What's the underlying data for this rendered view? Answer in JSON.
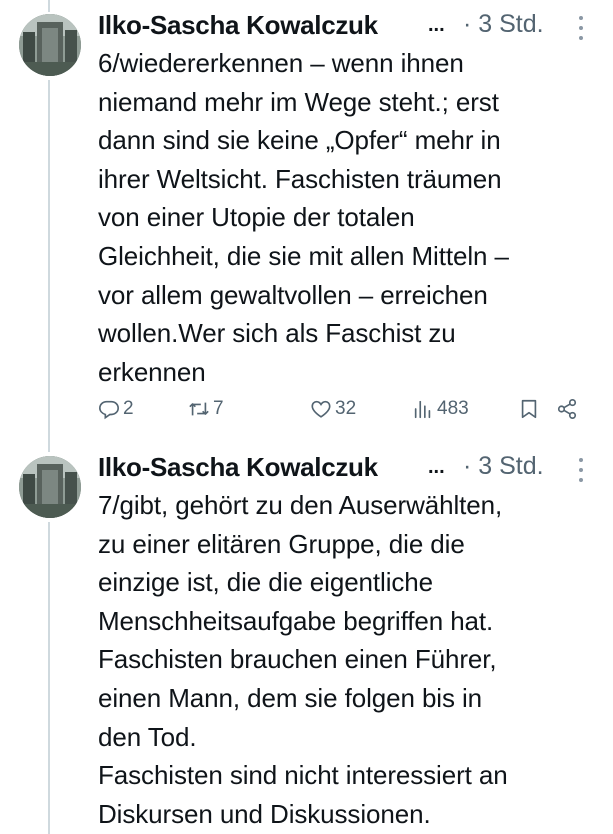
{
  "tweets": [
    {
      "author": "Ilko-Sascha Kowalczuk",
      "ellipsis": "...",
      "time": "· 3 Std.",
      "text": "6/wiedererkennen – wenn ihnen\nniemand mehr im Wege steht.; erst\ndann sind sie keine „Opfer“ mehr in\nihrer Weltsicht. Faschisten träumen\nvon einer Utopie der totalen\nGleichheit, die sie mit allen Mitteln –\nvor allem gewaltvollen – erreichen\nwollen.Wer sich als Faschist zu\nerkennen",
      "replies": "2",
      "retweets": "7",
      "likes": "32",
      "views": "483"
    },
    {
      "author": "Ilko-Sascha Kowalczuk",
      "ellipsis": "...",
      "time": "· 3 Std.",
      "text": "7/gibt, gehört zu den Auserwählten,\nzu einer elitären Gruppe, die die\neinzige ist, die die eigentliche\nMenschheitsaufgabe begriffen hat.\nFaschisten brauchen einen Führer,\neinen Mann, dem sie folgen bis in\nden Tod.\nFaschisten sind nicht interessiert an\nDiskursen und Diskussionen."
    }
  ],
  "icons": {
    "reply": "reply-icon",
    "retweet": "retweet-icon",
    "like": "heart-icon",
    "views": "views-icon",
    "bookmark": "bookmark-icon",
    "share": "share-icon",
    "more": "more-icon"
  },
  "colors": {
    "text": "#0f1419",
    "secondary": "#536471",
    "thread_line": "#cfd9de"
  }
}
